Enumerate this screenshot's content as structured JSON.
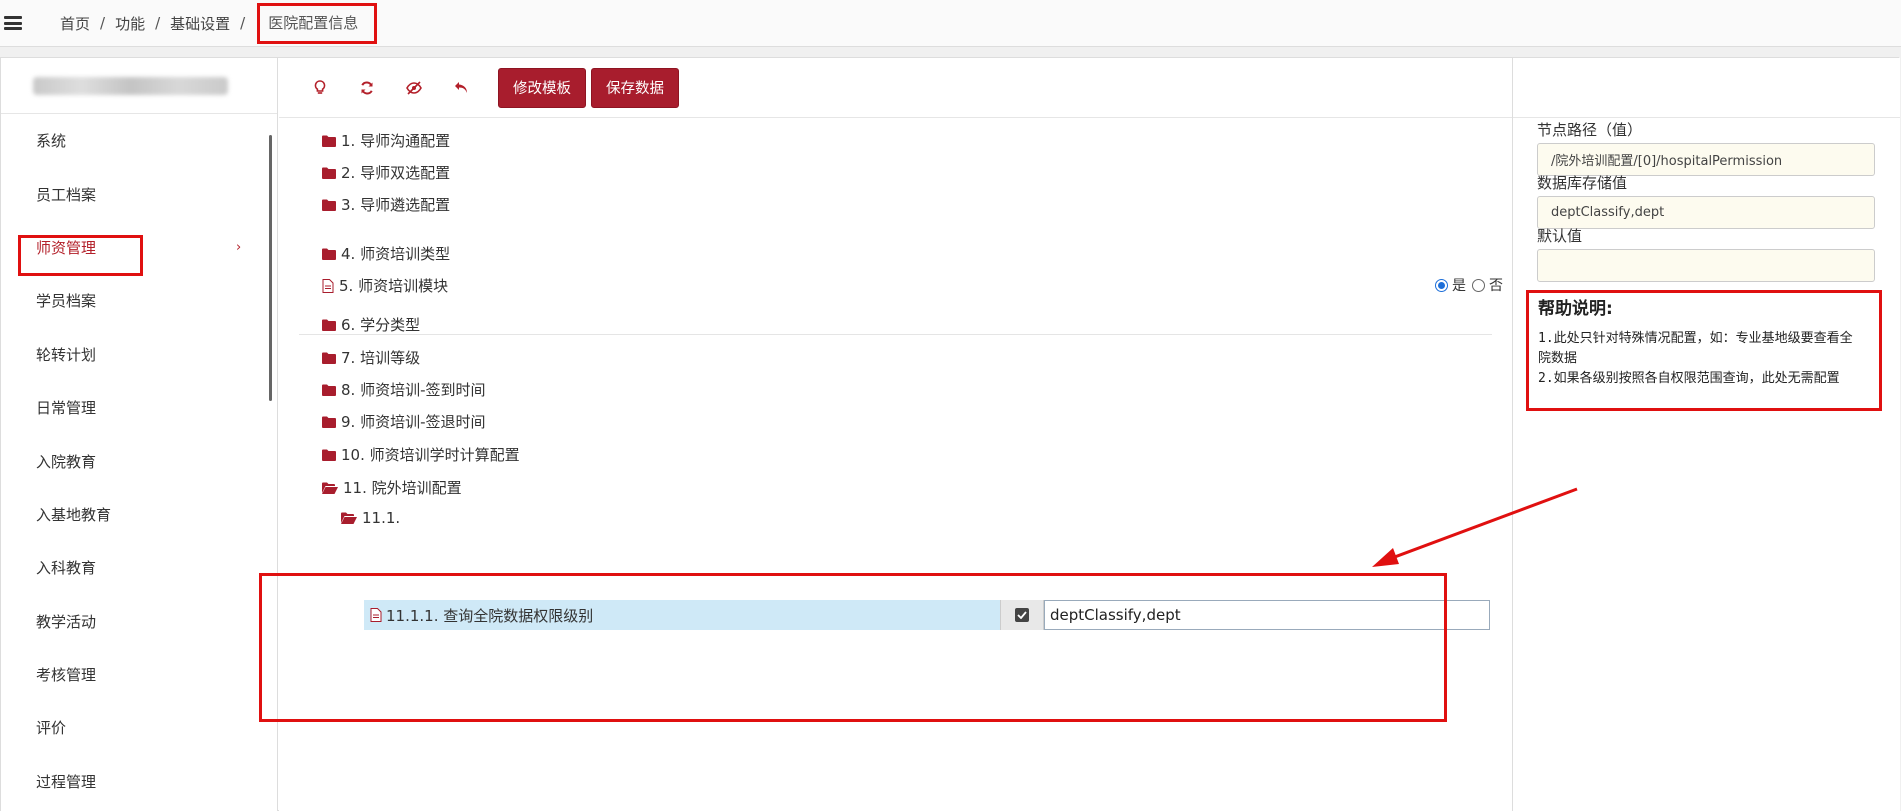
{
  "breadcrumb": {
    "items": [
      "首页",
      "功能",
      "基础设置"
    ],
    "current": "医院配置信息",
    "separator": "/"
  },
  "sidebar": {
    "items": [
      {
        "label": "系统"
      },
      {
        "label": "员工档案"
      },
      {
        "label": "师资管理",
        "active": true
      },
      {
        "label": "学员档案"
      },
      {
        "label": "轮转计划"
      },
      {
        "label": "日常管理"
      },
      {
        "label": "入院教育"
      },
      {
        "label": "入基地教育"
      },
      {
        "label": "入科教育"
      },
      {
        "label": "教学活动"
      },
      {
        "label": "考核管理"
      },
      {
        "label": "评价"
      },
      {
        "label": "过程管理"
      }
    ],
    "chevron": "›"
  },
  "toolbar": {
    "icons": [
      "lightbulb-icon",
      "refresh-icon",
      "eye-slash-icon",
      "undo-icon"
    ],
    "edit_template_label": "修改模板",
    "save_data_label": "保存数据"
  },
  "tree": {
    "items": [
      {
        "label": "1. 导师沟通配置",
        "type": "folder"
      },
      {
        "label": "2. 导师双选配置",
        "type": "folder"
      },
      {
        "label": "3. 导师遴选配置",
        "type": "folder"
      },
      {
        "label": "4. 师资培训类型",
        "type": "folder"
      },
      {
        "label": "5. 师资培训模块",
        "type": "file"
      },
      {
        "label": "6. 学分类型",
        "type": "folder"
      },
      {
        "label": "7. 培训等级",
        "type": "folder"
      },
      {
        "label": "8. 师资培训-签到时间",
        "type": "folder"
      },
      {
        "label": "9. 师资培训-签退时间",
        "type": "folder"
      },
      {
        "label": "10. 师资培训学时计算配置",
        "type": "folder"
      },
      {
        "label": "11. 院外培训配置",
        "type": "folder-open"
      },
      {
        "label": "11.1.",
        "type": "folder-open"
      }
    ],
    "radio": {
      "yes_label": "是",
      "no_label": "否",
      "selected": "是"
    },
    "leaf": {
      "label": "11.1.1. 查询全院数据权限级别",
      "checked": true,
      "value": "deptClassify,dept"
    }
  },
  "right_panel": {
    "node_path_label": "节点路径（值）",
    "node_path_value": "/院外培训配置/[0]/hospitalPermission",
    "db_value_label": "数据库存储值",
    "db_value": "deptClassify,dept",
    "default_label": "默认值",
    "default_value": ""
  },
  "help": {
    "title": "帮助说明:",
    "line1": "1.此处只针对特殊情况配置，如：专业基地级要查看全",
    "line1b": "院数据",
    "line2": "2.如果各级别按照各自权限范围查询，此处无需配置"
  },
  "colors": {
    "brand": "#a81d2d",
    "annotation": "#e01010",
    "selected_row": "#cfe9f7",
    "radio_selected": "#1e6fd9"
  }
}
